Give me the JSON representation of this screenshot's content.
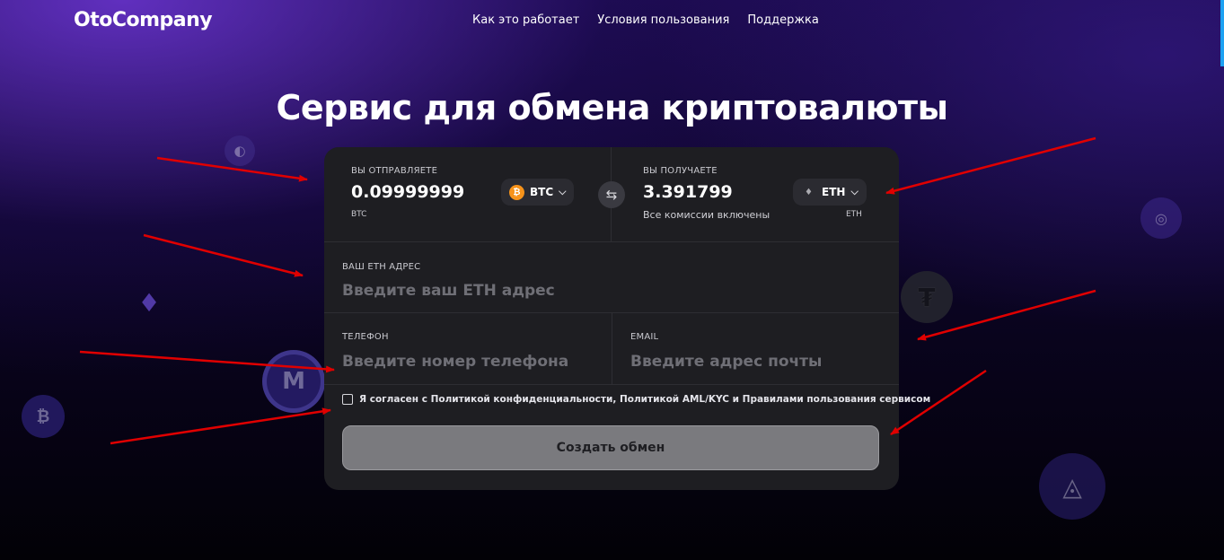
{
  "nav": {
    "logo": "OtoCompany",
    "links": [
      "Как это работает",
      "Условия пользования",
      "Поддержка"
    ]
  },
  "hero": {
    "title": "Сервис для обмена криптовалюты"
  },
  "exchange": {
    "send": {
      "label": "ВЫ ОТПРАВЛЯЕТЕ",
      "amount": "0.09999999",
      "currency_note": "BTC",
      "coin": "BTC"
    },
    "receive": {
      "label": "ВЫ ПОЛУЧАЕТЕ",
      "amount": "3.391799",
      "commission_note": "Все комиссии включены",
      "currency_note": "ETH",
      "coin": "ETH"
    },
    "swap_icon": "swap-arrows"
  },
  "form": {
    "address": {
      "label": "ВАШ ETH АДРЕС",
      "placeholder": "Введите ваш ETH адрес"
    },
    "phone": {
      "label": "ТЕЛЕФОН",
      "placeholder": "Введите номер телефона"
    },
    "email": {
      "label": "EMAIL",
      "placeholder": "Введите адрес почты"
    },
    "consent": "Я согласен с Политикой конфиденциальности, Политикой AML/KYC  и Правилами пользования сервисом",
    "submit": "Создать обмен"
  },
  "colors": {
    "accent": "#6b3fe0",
    "card": "#1e1e22",
    "button": "#7a7a7e",
    "annotation_arrow": "#e00000",
    "scroll_accent": "#1da1f2"
  }
}
